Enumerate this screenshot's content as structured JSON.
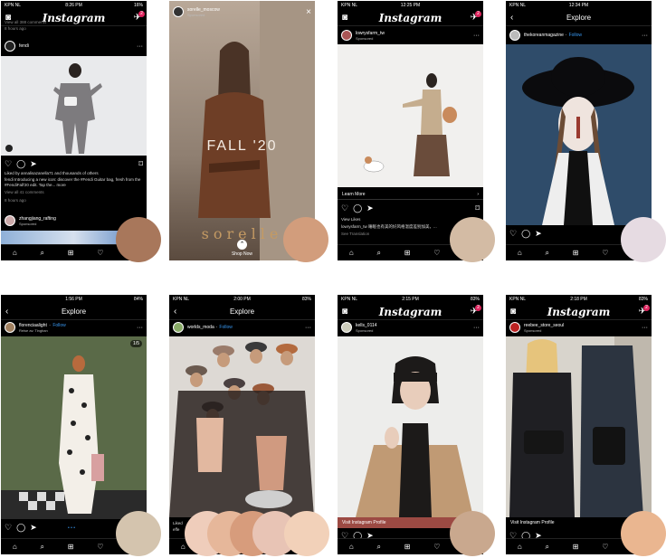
{
  "status": {
    "p1": {
      "carrier": "KPN NL",
      "time": "8:26 PM",
      "batt": "16%"
    },
    "p3": {
      "carrier": "KPN NL",
      "time": "12:25 PM",
      "batt": ""
    },
    "p4": {
      "carrier": "KPN NL",
      "time": "12:34 PM",
      "batt": ""
    },
    "p5": {
      "carrier": "",
      "time": "1:56 PM",
      "batt": "84%"
    },
    "p6": {
      "carrier": "KPN NL",
      "time": "2:00 PM",
      "batt": "83%"
    },
    "p7": {
      "carrier": "KPN NL",
      "time": "2:15 PM",
      "batt": "83%"
    },
    "p8": {
      "carrier": "KPN NL",
      "time": "2:18 PM",
      "batt": "83%"
    }
  },
  "app": {
    "logo": "Instagram",
    "explore": "Explore",
    "back": "‹",
    "follow": "Follow",
    "sponsored": "Sponsored",
    "more": "···"
  },
  "p1": {
    "top_line": "View all 388 comments",
    "top_time": "8 hours ago",
    "user": "fendi",
    "liked": "Liked by annalisazanella71 and thousands of others",
    "caption": "fendi Introducing a new icon: discover the #Fendi Guitar bag, fresh from the #FendiFall'20 edit. Tap the... more",
    "comments": "View all 41 comments",
    "time": "8 hours ago",
    "next_user": "zhangjiang_rafting",
    "next_sub": "Sponsored",
    "badge": "2"
  },
  "p2": {
    "user": "sorelle_moscow",
    "sub": "Sponsored",
    "close": "×",
    "fall": "FALL '20",
    "brand": "sorelle",
    "shop": "Shop Now",
    "shop_icon": "⌃"
  },
  "p3": {
    "user": "lowrysfarm_tw",
    "sub": "Sponsored",
    "learn": "Learn More",
    "learn_arr": "›",
    "likes": "View Likes",
    "caption": "lowrysfarm_tw 睡眠也有美的好风格温度差别加美，...",
    "translate": "See Translation",
    "badge": "2"
  },
  "p4": {
    "user": "thekoreanmagazine",
    "follow": "Follow"
  },
  "p5": {
    "user": "florenciaalight",
    "follow": "Follow",
    "sub": "Reise av. Tinghan",
    "counter": "1/5"
  },
  "p6": {
    "user": "worlds_moda",
    "follow": "Follow",
    "cut1": "Liked",
    "cut2": "effe"
  },
  "p7": {
    "user": "kells_0114",
    "sub": "Sponsored",
    "cta": "Visit Instagram Profile",
    "badge": "2"
  },
  "p8": {
    "user": "reebee_store_seoul",
    "sub": "Sponsored",
    "cta": "Visit Instagram Profile",
    "badge": "2"
  },
  "icons": {
    "home": "⌂",
    "search": "⌕",
    "add": "⊞",
    "heart": "♡",
    "profile": "◯",
    "camera": "◙",
    "dm": "✈",
    "comment": "◯",
    "share": "➤",
    "save": "⌑",
    "more": "›"
  },
  "colors": {
    "p1_swatch": "#a8775b",
    "p2_swatch": "#d29d7c",
    "p3_swatch": "#d3bba4",
    "p4_swatch": "#e6dbe2",
    "p5_swatch": "#d4c4ae",
    "p6_swatches": [
      "#efcdbb",
      "#e6b79a",
      "#d79c7c",
      "#e8c4b5",
      "#f2d1b9"
    ],
    "p7_swatch": "#c9a88e",
    "p8_swatch": "#eab690",
    "cta_red": "#9c4a43"
  }
}
